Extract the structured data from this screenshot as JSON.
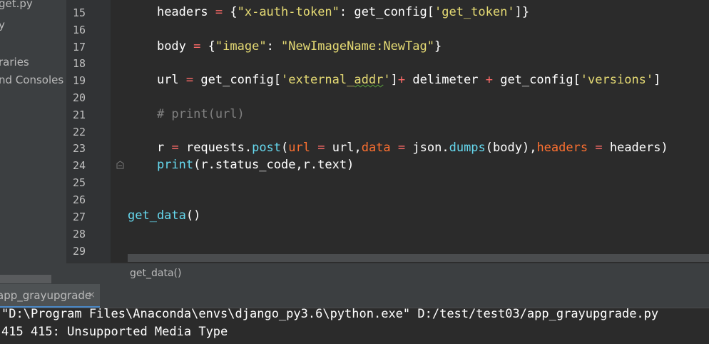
{
  "sidebar": {
    "items": [
      {
        "label": "get.py"
      },
      {
        "label": "y"
      },
      {
        "label": "raries"
      },
      {
        "label": "nd Consoles"
      }
    ]
  },
  "editor": {
    "line_numbers": [
      "15",
      "16",
      "17",
      "18",
      "19",
      "20",
      "21",
      "22",
      "23",
      "24",
      "25",
      "26",
      "27",
      "28",
      "29"
    ],
    "l15": {
      "indent": "    ",
      "headers": "headers",
      "eq": "=",
      "open": "{",
      "k": "\"x-auth-token\"",
      "colon": ": ",
      "call": "get_config[",
      "arg": "'get_token'",
      "close": "]}"
    },
    "l17": {
      "indent": "    ",
      "body": "body",
      "eq": "=",
      "open": "{",
      "k": "\"image\"",
      "colon": ": ",
      "v": "\"NewImageName:NewTag\"",
      "close": "}"
    },
    "l19": {
      "indent": "    ",
      "url": "url",
      "eq": "=",
      "call1": "get_config[",
      "arg1_a": "'external_",
      "arg1_b": "addr",
      "arg1_c": "'",
      "close1": "]",
      "plus1": "+",
      "delim": "delimeter",
      "plus2": "+",
      "call2": "get_config[",
      "arg2": "'versions'",
      "close2": "]"
    },
    "l21": {
      "indent": "    ",
      "comment": "# print(url)"
    },
    "l23": {
      "indent": "    ",
      "r": "r",
      "eq": "=",
      "obj": "requests.",
      "fn": "post",
      "open": "(",
      "p1": "url",
      "eq1": "=",
      "v1": "url,",
      "p2": "data",
      "eq2": "=",
      "v2a": "json.",
      "v2fn": "dumps",
      "v2b": "(body),",
      "p3": "headers",
      "eq3": "=",
      "v3": "headers)"
    },
    "l24": {
      "indent": "    ",
      "fn": "print",
      "rest": "(r.status_code,r.text)"
    },
    "l27": {
      "fn": "get_data",
      "rest": "()"
    }
  },
  "breadcrumb": {
    "label": "get_data()"
  },
  "run": {
    "tab_label": "app_grayupgrade",
    "close_icon": "×",
    "console_lines": [
      "\"D:\\Program Files\\Anaconda\\envs\\django_py3.6\\python.exe\" D:/test/test03/app_grayupgrade.py",
      "415 415: Unsupported Media Type"
    ]
  },
  "colors": {
    "background": "#2b2b2b",
    "string": "#e6db74",
    "function": "#66d9ef",
    "operator": "#ff6b68",
    "param": "#fd7030",
    "comment": "#808080",
    "accent": "#4a88c7"
  }
}
